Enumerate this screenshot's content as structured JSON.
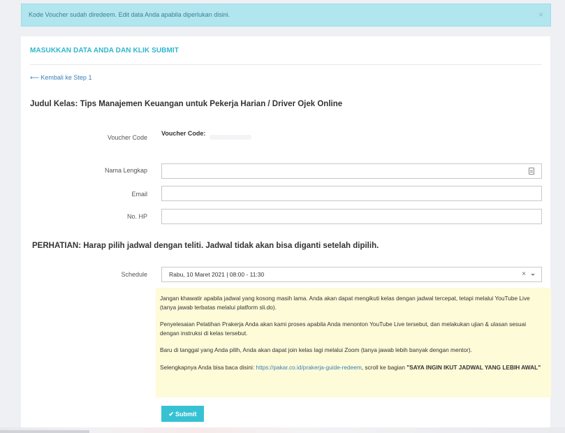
{
  "alert": {
    "message": "Kode Voucher sudah diredeem. Edit data Anda apabila diperlukan disini.",
    "close": "×"
  },
  "panel": {
    "title": "MASUKKAN DATA ANDA DAN KLIK SUBMIT",
    "back_link": "⟵ Kembali ke Step 1",
    "course_title": "Judul Kelas: Tips Manajemen Keuangan untuk Pekerja Harian / Driver Ojek Online"
  },
  "form": {
    "voucher": {
      "label": "Voucher Code",
      "value_label": "Voucher Code:"
    },
    "name": {
      "label": "Nama Lengkap",
      "value": ""
    },
    "email": {
      "label": "Email",
      "value": ""
    },
    "phone": {
      "label": "No. HP",
      "value": ""
    },
    "warning": "PERHATIAN: Harap pilih jadwal dengan teliti. Jadwal tidak akan bisa diganti setelah dipilih.",
    "schedule": {
      "label": "Schedule",
      "selected": "Rabu, 10 Maret 2021 | 08:00 - 11:30",
      "clear": "×"
    }
  },
  "info": {
    "p1": "Jangan khawatir apabila jadwal yang kosong masih lama. Anda akan dapat mengikuti kelas dengan jadwal tercepat, tetapi melalui YouTube Live (tanya jawab terbatas melalui platform sli.do).",
    "p2": "Penyelesaian Pelatihan Prakerja Anda akan kami proses apabila Anda menonton YouTube Live tersebut, dan melakukan ujian & ulasan sesuai dengan instruksi di kelas tersebut.",
    "p3": "Baru di tanggal yang Anda pilih, Anda akan dapat join kelas lagi melalui Zoom (tanya jawab lebih banyak dengan mentor).",
    "p4_prefix": "Selengkapnya Anda bisa baca disini: ",
    "p4_link": "https://pakar.co.id/prakerja-guide-redeem",
    "p4_middle": ", scroll ke bagian ",
    "p4_bold": "\"SAYA INGIN IKUT JADWAL YANG LEBIH AWAL\""
  },
  "submit": {
    "icon": "✔",
    "label": "Submit"
  },
  "icons": {
    "close": "close-icon",
    "contact_card": "contact-card-icon",
    "check": "check-icon",
    "caret": "chevron-down-icon"
  }
}
